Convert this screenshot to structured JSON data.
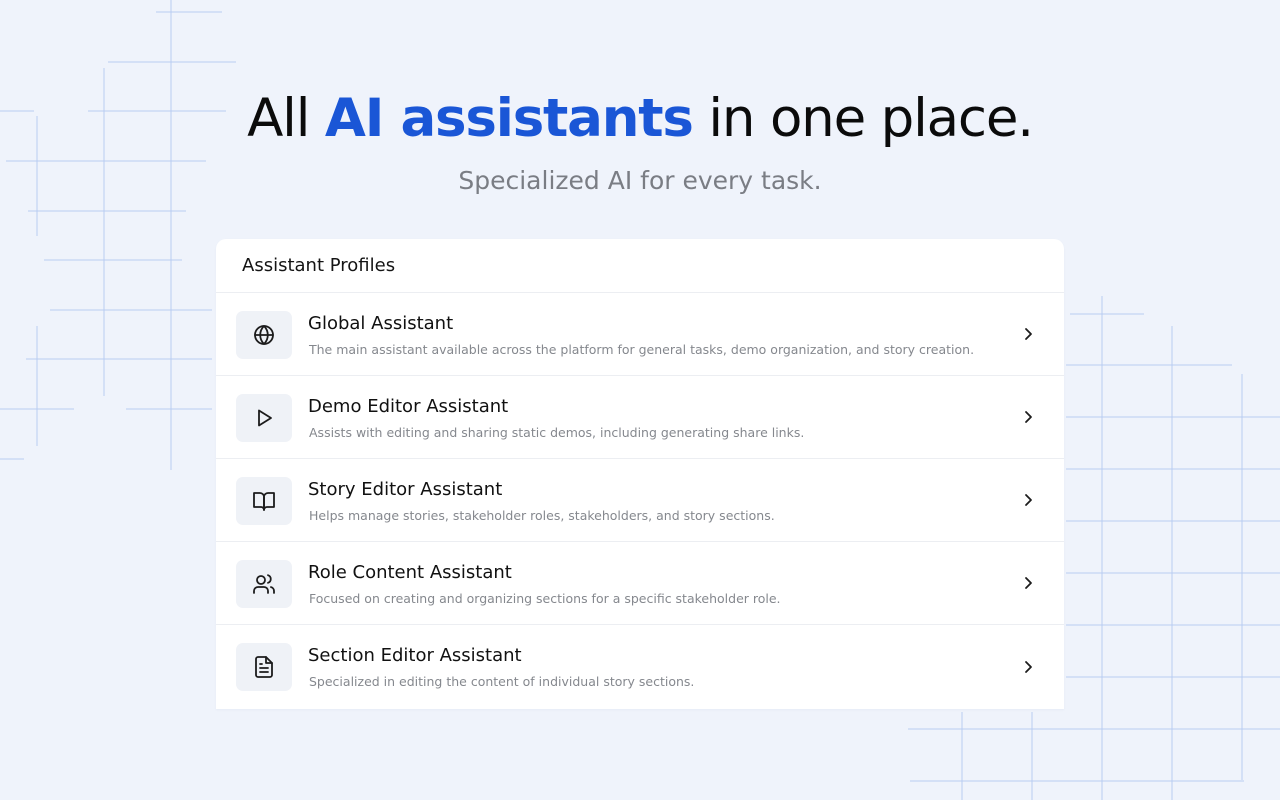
{
  "hero": {
    "title_prefix": "All ",
    "title_accent": "AI assistants",
    "title_suffix": " in one place.",
    "subtitle": "Specialized AI for every task."
  },
  "card": {
    "header": "Assistant Profiles",
    "items": [
      {
        "icon": "globe-icon",
        "title": "Global Assistant",
        "description": "The main assistant available across the platform for general tasks, demo organization, and story creation."
      },
      {
        "icon": "play-icon",
        "title": "Demo Editor Assistant",
        "description": "Assists with editing and sharing static demos, including generating share links."
      },
      {
        "icon": "book-open-icon",
        "title": "Story Editor Assistant",
        "description": "Helps manage stories, stakeholder roles, stakeholders, and story sections."
      },
      {
        "icon": "users-icon",
        "title": "Role Content Assistant",
        "description": "Focused on creating and organizing sections for a specific stakeholder role."
      },
      {
        "icon": "file-text-icon",
        "title": "Section Editor Assistant",
        "description": "Specialized in editing the content of individual story sections."
      }
    ]
  },
  "colors": {
    "background": "#eff3fb",
    "accent": "#1a56d6",
    "grid_line": "#b9cdf1"
  }
}
